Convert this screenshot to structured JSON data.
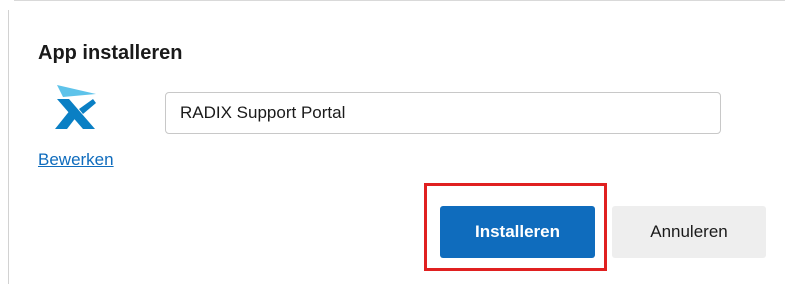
{
  "dialog": {
    "title": "App installeren",
    "app_icon": "radix-x-logo-icon",
    "edit_link": "Bewerken",
    "app_name_value": "RADIX Support Portal",
    "install_label": "Installeren",
    "cancel_label": "Annuleren"
  },
  "colors": {
    "accent": "#0f6cbd",
    "highlight": "#e02020",
    "cancel_bg": "#eeeeee",
    "logo_light": "#5ec3ea",
    "logo_dark": "#0a7fc4"
  }
}
